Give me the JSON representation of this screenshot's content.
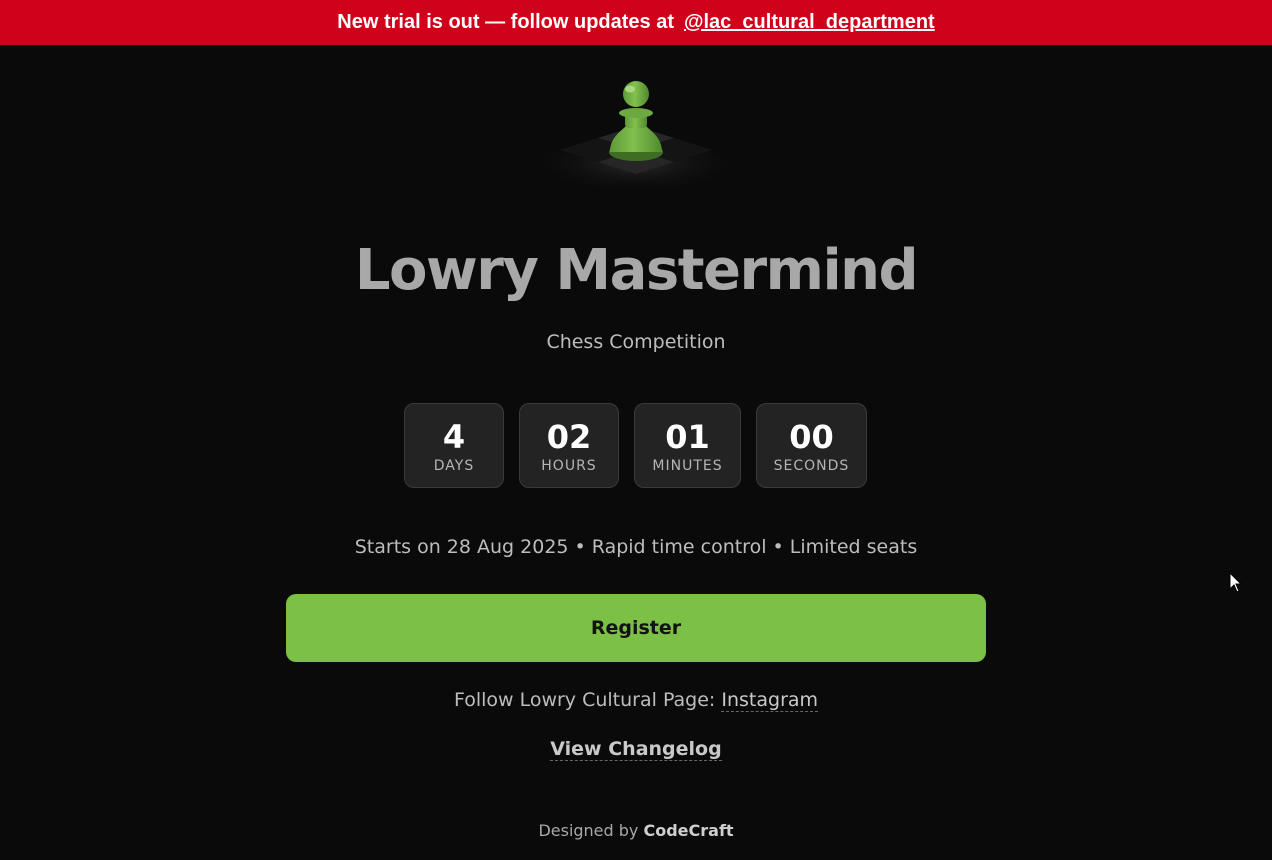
{
  "announcement": {
    "text": "New trial is out — follow updates at",
    "link_text": "@lac_cultural_department"
  },
  "logo": {
    "icon": "chess-pawn-icon",
    "pawn_color": "#6da843"
  },
  "hero": {
    "title": "Lowry Mastermind",
    "subtitle": "Chess Competition"
  },
  "countdown": [
    {
      "value": "4",
      "label": "DAYS"
    },
    {
      "value": "02",
      "label": "HOURS"
    },
    {
      "value": "01",
      "label": "MINUTES"
    },
    {
      "value": "00",
      "label": "SECONDS"
    }
  ],
  "details": "Starts on 28 Aug 2025 • Rapid time control • Limited seats",
  "register_label": "Register",
  "follow": {
    "text": "Follow Lowry Cultural Page:",
    "link_text": "Instagram"
  },
  "changelog_label": "View Changelog",
  "footer": {
    "prefix": "Designed by",
    "brand": "CodeCraft"
  },
  "colors": {
    "banner": "#d0021b",
    "accent": "#7cc146",
    "background": "#0a0a0a"
  }
}
